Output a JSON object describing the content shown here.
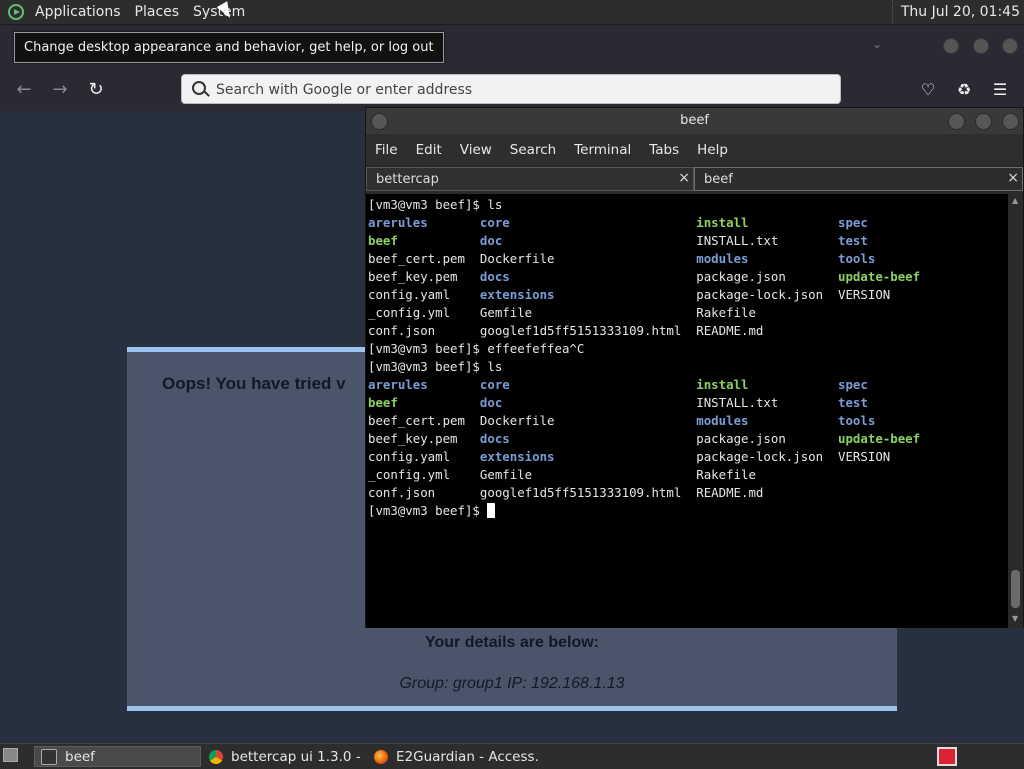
{
  "top_panel": {
    "menus": [
      "Applications",
      "Places",
      "System"
    ],
    "clock": "Thu Jul 20, 01:45"
  },
  "tooltip": "Change desktop appearance and behavior, get help, or log out",
  "browser": {
    "search_placeholder": "Search with Google or enter address",
    "page": {
      "title": "Oops! You have tried v",
      "details_heading": "Your details are below:",
      "details_line": "Group: group1   IP: 192.168.1.13"
    }
  },
  "terminal": {
    "title": "beef",
    "menu": [
      "File",
      "Edit",
      "View",
      "Search",
      "Terminal",
      "Tabs",
      "Help"
    ],
    "tabs": [
      {
        "label": "bettercap",
        "close": "×"
      },
      {
        "label": "beef",
        "close": "×"
      }
    ],
    "prompt": "[vm3@vm3 beef]$",
    "commands": {
      "first": "ls",
      "interrupted": "effeefeffea^C",
      "second": "ls"
    },
    "listing": [
      [
        [
          "arerules",
          "dir"
        ],
        [
          "core",
          "dir"
        ],
        [
          "install",
          "exe"
        ],
        [
          "spec",
          "dir"
        ]
      ],
      [
        [
          "beef",
          "exe"
        ],
        [
          "doc",
          "dir"
        ],
        [
          "INSTALL.txt",
          "fil"
        ],
        [
          "test",
          "dir"
        ]
      ],
      [
        [
          "beef_cert.pem",
          "fil"
        ],
        [
          "Dockerfile",
          "fil"
        ],
        [
          "modules",
          "dir"
        ],
        [
          "tools",
          "dir"
        ]
      ],
      [
        [
          "beef_key.pem",
          "fil"
        ],
        [
          "docs",
          "dir"
        ],
        [
          "package.json",
          "fil"
        ],
        [
          "update-beef",
          "exe"
        ]
      ],
      [
        [
          "config.yaml",
          "fil"
        ],
        [
          "extensions",
          "dir"
        ],
        [
          "package-lock.json",
          "fil"
        ],
        [
          "VERSION",
          "fil"
        ]
      ],
      [
        [
          "_config.yml",
          "fil"
        ],
        [
          "Gemfile",
          "fil"
        ],
        [
          "Rakefile",
          "fil"
        ],
        [
          "",
          ""
        ]
      ],
      [
        [
          "conf.json",
          "fil"
        ],
        [
          "googlef1d5ff5151333109.html",
          "fil"
        ],
        [
          "README.md",
          "fil"
        ],
        [
          "",
          ""
        ]
      ]
    ]
  },
  "taskbar": {
    "tasks": [
      {
        "label": "beef",
        "active": true
      },
      {
        "label": "bettercap ui 1.3.0 - …",
        "active": false
      },
      {
        "label": "E2Guardian - Access…",
        "active": false
      }
    ]
  }
}
